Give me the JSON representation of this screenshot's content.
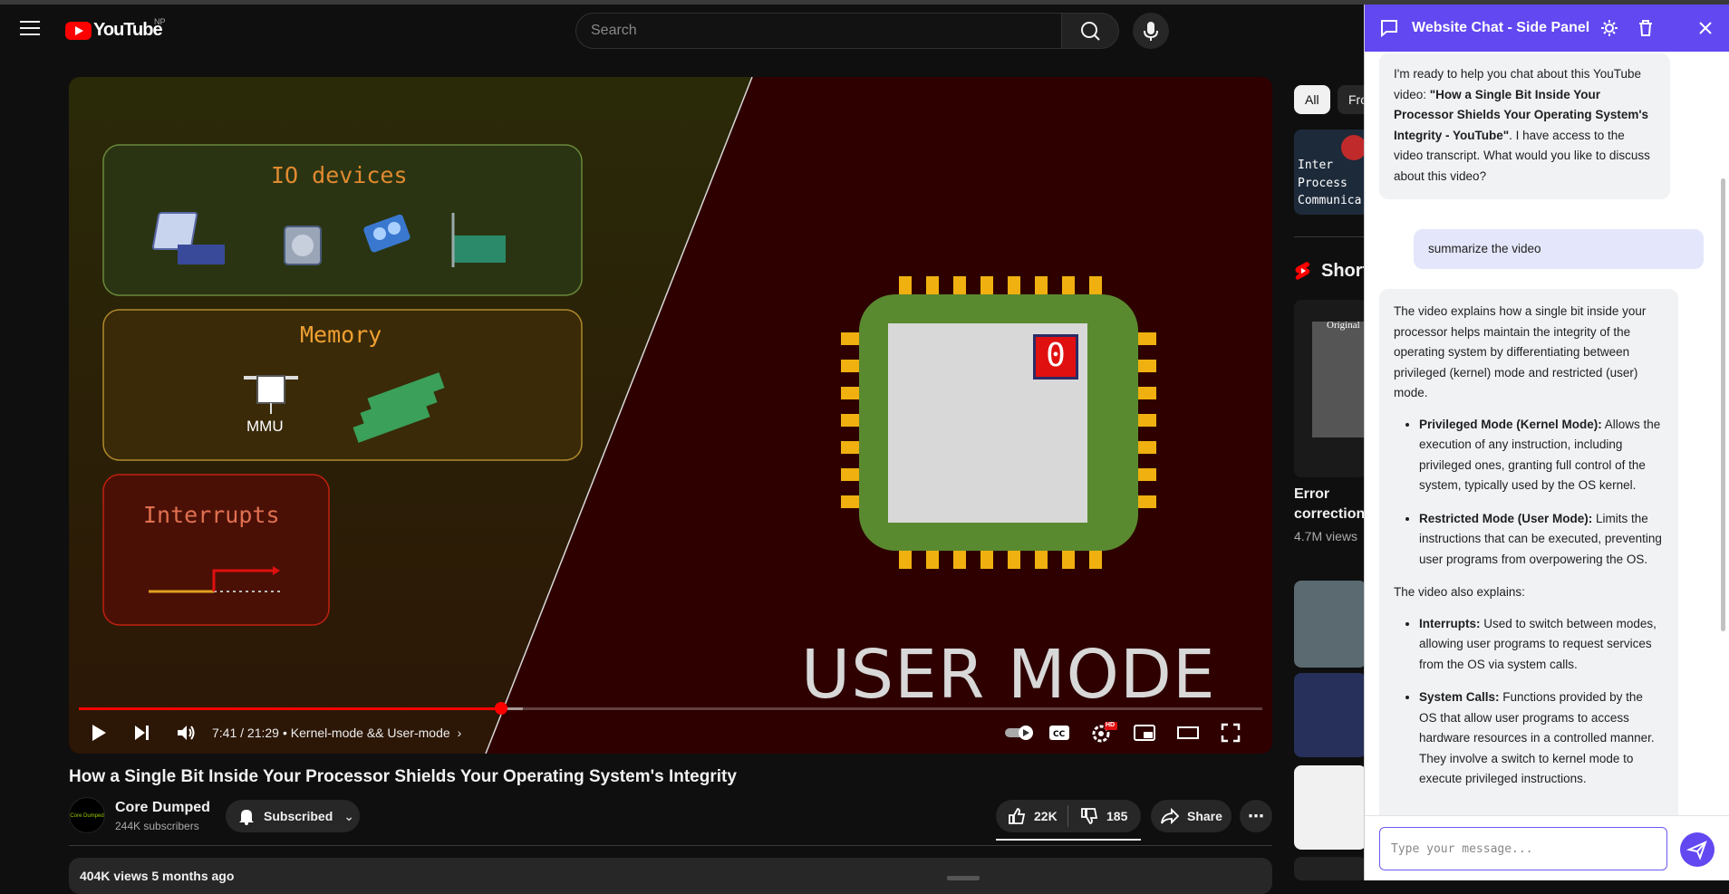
{
  "masthead": {
    "logo_text": "YouTube",
    "country_code": "NP",
    "search_placeholder": "Search"
  },
  "player": {
    "scene": {
      "io_title": "IO devices",
      "memory_title": "Memory",
      "mmu_label": "MMU",
      "interrupts_title": "Interrupts",
      "mode_bit": "0",
      "mode_text": "USER MODE"
    },
    "time": "7:41 / 21:29",
    "chapter": "• Kernel-mode && User-mode",
    "progress_fraction": 0.357,
    "loaded_fraction": 0.375,
    "hd_badge": "HD"
  },
  "video": {
    "title": "How a Single Bit Inside Your Processor Shields Your Operating System's Integrity",
    "channel": "Core Dumped",
    "channel_avatar_text": "Core Dumped",
    "subscribers": "244K subscribers",
    "subscribed_label": "Subscribed",
    "likes": "22K",
    "dislikes": "185",
    "share_label": "Share",
    "views_meta": "404K views  5 months ago"
  },
  "sidebar": {
    "chips": [
      "All",
      "Fro"
    ],
    "rec1_thumb_lines": [
      "Inter",
      "Process",
      "Communica"
    ],
    "shorts_label": "Short",
    "short1_title_line1": "Error",
    "short1_title_line2": "correction",
    "short1_views": "4.7M views",
    "short1_overlay": "Original"
  },
  "panel": {
    "title": "Website Chat - Side Panel",
    "messages": {
      "ai1": {
        "intro": "I'm ready to help you chat about this YouTube video: ",
        "bold": "\"How a Single Bit Inside Your Processor Shields Your Operating System's Integrity - YouTube\"",
        "outro": ". I have access to the video transcript. What would you like to discuss about this video?"
      },
      "user1": "summarize the video",
      "ai2": {
        "para1": "The video explains how a single bit inside your processor helps maintain the integrity of the operating system by differentiating between privileged (kernel) mode and restricted (user) mode.",
        "b1_title": "Privileged Mode (Kernel Mode):",
        "b1_text": " Allows the execution of any instruction, including privileged ones, granting full control of the system, typically used by the OS kernel.",
        "b2_title": "Restricted Mode (User Mode):",
        "b2_text": " Limits the instructions that can be executed, preventing user programs from overpowering the OS.",
        "para2": "The video also explains:",
        "b3_title": "Interrupts:",
        "b3_text": " Used to switch between modes, allowing user programs to request services from the OS via system calls.",
        "b4_title": "System Calls:",
        "b4_text": " Functions provided by the OS that allow user programs to access hardware resources in a controlled manner. They involve a switch to kernel mode to execute privileged instructions."
      }
    },
    "input_placeholder": "Type your message...",
    "accent": "#6148f0"
  }
}
